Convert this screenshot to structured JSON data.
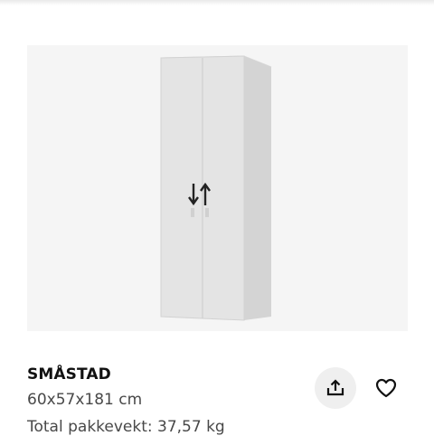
{
  "product": {
    "name": "SMÅSTAD",
    "dimensions": "60x57x181 cm",
    "weight": "Total pakkevekt: 37,57 kg"
  },
  "image": {
    "background_color": "#f5f5f5",
    "wardrobe_color": "#e4e4e4",
    "handle_icon": "up-down-arrows-icon"
  },
  "actions": {
    "share_icon": "share-icon",
    "favorite_icon": "heart-icon"
  }
}
